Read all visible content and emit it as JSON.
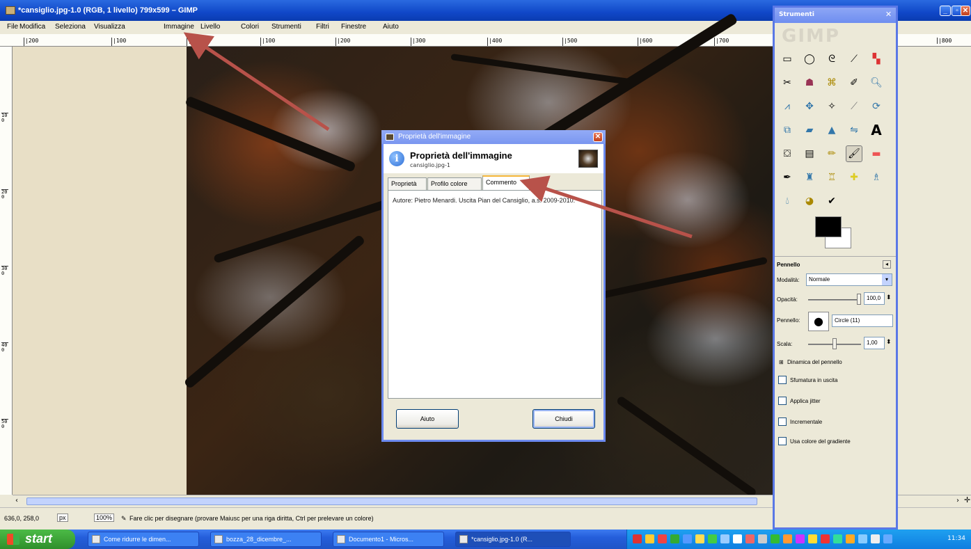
{
  "window": {
    "title": "*cansiglio.jpg-1.0 (RGB, 1 livello) 799x599 – GIMP"
  },
  "menu": [
    "File",
    "Modifica",
    "Seleziona",
    "Visualizza",
    "Immagine",
    "Livello",
    "Colori",
    "Strumenti",
    "Filtri",
    "Finestre",
    "Aiuto"
  ],
  "ruler": {
    "top": [
      "|200",
      "|100",
      "|0",
      "|100",
      "|200",
      "|300",
      "|400",
      "|500",
      "|600",
      "|700",
      "|800"
    ],
    "left": [
      "100",
      "200",
      "300",
      "400",
      "500"
    ]
  },
  "status": {
    "coords": "636,0, 258,0",
    "unit": "px",
    "zoom": "100%",
    "message": "Fare clic per disegnare (provare Maiusc per una riga diritta, Ctrl per prelevare un colore)"
  },
  "dialog": {
    "window_title": "Proprietà dell'immagine",
    "header_title": "Proprietà dell'immagine",
    "header_subtitle": "cansiglio.jpg-1",
    "tabs": [
      "Proprietà",
      "Profilo colore",
      "Commento"
    ],
    "active_tab": "Commento",
    "comment": "Autore: Pietro Menardi. Uscita Pian del Cansiglio, a.s. 2009-2010.",
    "help_button": "Aiuto",
    "close_button": "Chiudi"
  },
  "toolbox": {
    "title": "Strumenti",
    "logo": "GIMP",
    "tool_options_title": "Pennello",
    "mode_label": "Modalità:",
    "mode_value": "Normale",
    "opacity_label": "Opacità:",
    "opacity_value": "100,0",
    "opacity": 1.0,
    "brush_label": "Pennello:",
    "brush_value": "Circle (11)",
    "scale_label": "Scala:",
    "scale_value": "1,00",
    "scale": 0.5,
    "dynamics_label": "Dinamica del pennello",
    "options": [
      "Sfumatura in uscita",
      "Applica jitter",
      "Incrementale",
      "Usa colore del gradiente"
    ]
  },
  "taskbar": {
    "start_label": "start",
    "tasks": [
      "Come ridurre le dimen...",
      "bozza_28_dicembre_...",
      "Documento1 - Micros...",
      "*cansiglio.jpg-1.0 (R..."
    ],
    "clock": "11:34"
  },
  "colors": {
    "title_bar": "#1047c8",
    "annotation_arrow": "#b8524a",
    "taskbar": "#245edb",
    "start_button": "#3a9e34"
  }
}
